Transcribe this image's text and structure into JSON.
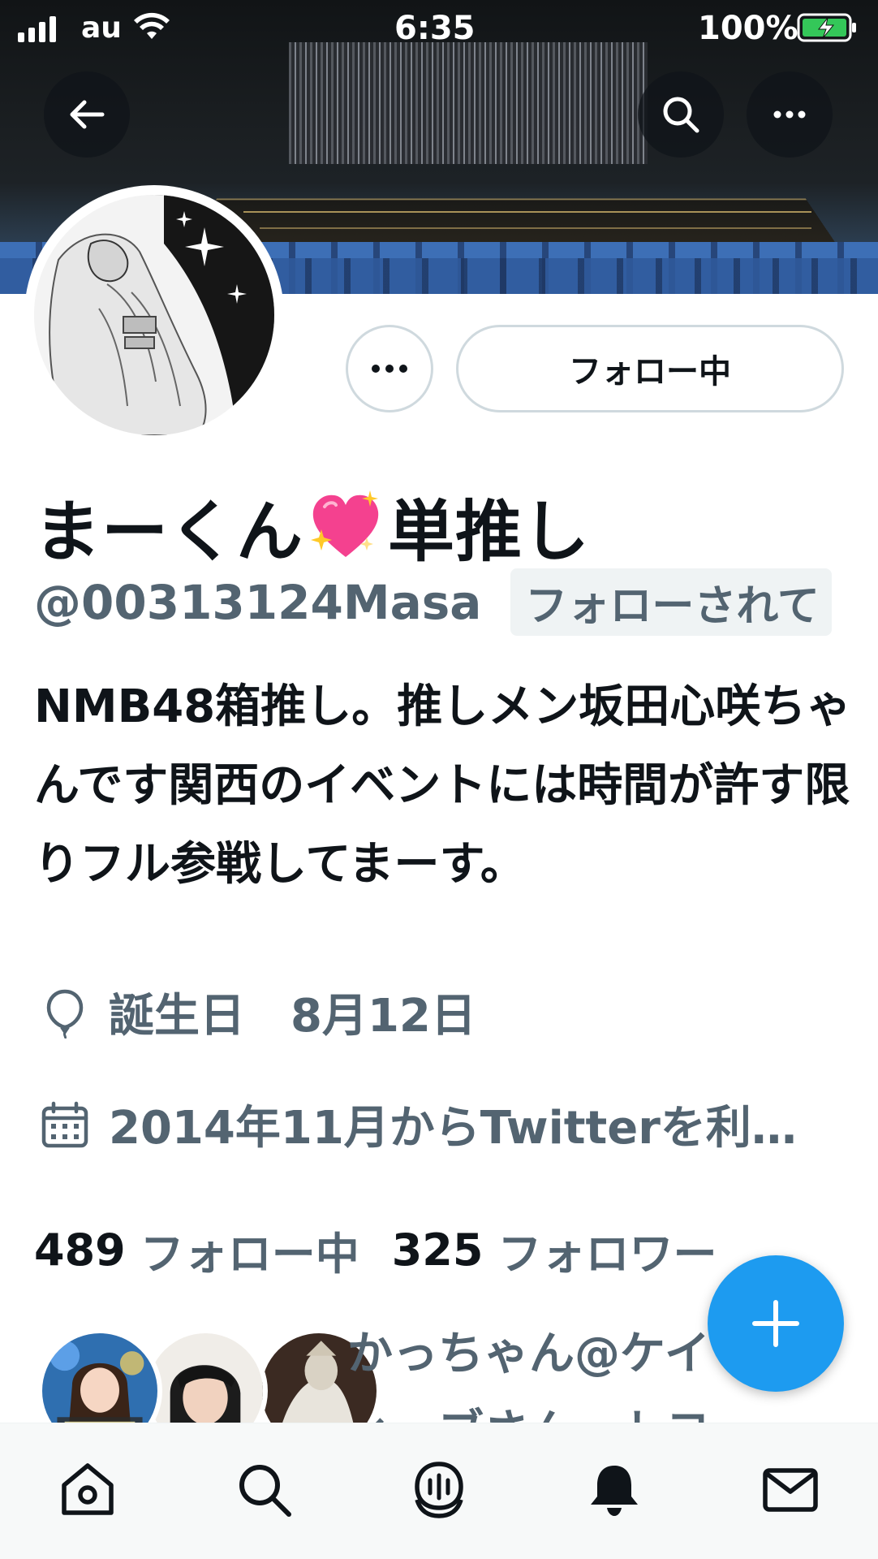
{
  "status_bar": {
    "carrier": "au",
    "time": "6:35",
    "battery": "100%"
  },
  "profile": {
    "follow_button_label": "フォロー中",
    "name_before_emoji": "まーくん",
    "name_emoji": "sparkling-heart-emoji",
    "name_after_emoji": "単推し",
    "handle": "@00313124Masa",
    "follows_you_badge": "フォローされて",
    "bio": "NMB48箱推し。推しメン坂田心咲ちゃんです関西のイベントには時間が許す限りフル参戦してまーす。",
    "birthday": "誕生日　8月12日",
    "joined": "2014年11月からTwitterを利…"
  },
  "counts": {
    "following_count": "489",
    "following_label": "フォロー中",
    "followers_count": "325",
    "followers_label": "フォロワー"
  },
  "followers_you_know": {
    "text_line1": "かっちゃん@ケイ",
    "text_line2": "ィ〜ブさん、トヨ"
  },
  "colors": {
    "accent": "#1d9bf0",
    "secondary_text": "#536471",
    "primary_text": "#0f1419"
  },
  "icons": {
    "header": [
      "back-arrow-icon",
      "search-icon",
      "more-icon"
    ],
    "meta": [
      "balloon-icon",
      "calendar-icon"
    ],
    "nav": [
      "home-icon",
      "search-icon",
      "spaces-icon",
      "notifications-icon",
      "messages-icon"
    ]
  }
}
